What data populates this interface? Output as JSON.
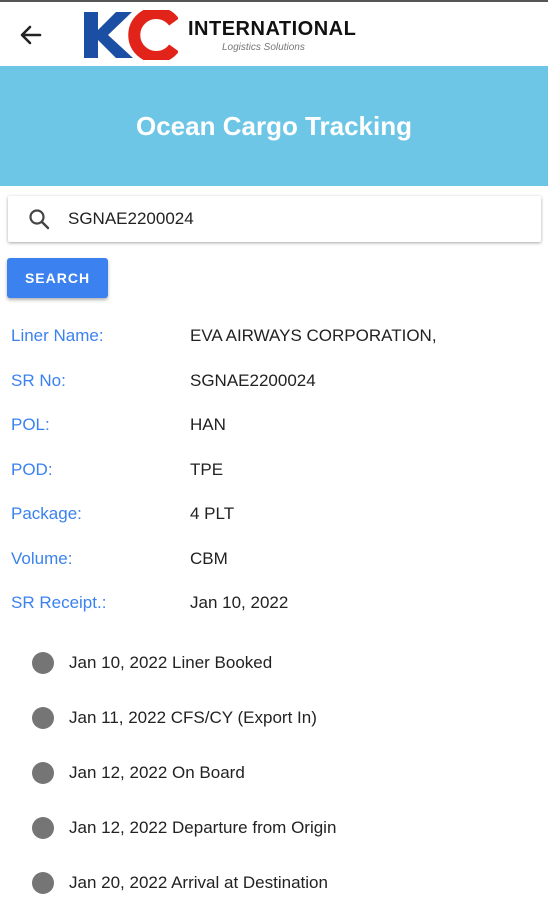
{
  "header": {
    "back_icon": "arrow-left-icon",
    "logo_mark": "KC",
    "logo_title": "INTERNATIONAL",
    "logo_subtitle": "Logistics Solutions",
    "colors": {
      "logo_k": "#1a4fa3",
      "logo_c": "#e2231a"
    }
  },
  "banner": {
    "title": "Ocean Cargo Tracking",
    "color": "#6ec6e6"
  },
  "search": {
    "icon": "search-icon",
    "value": "SGNAE2200024",
    "button_label": "SEARCH",
    "button_color": "#3b82f0"
  },
  "details": [
    {
      "label": "Liner Name:",
      "value": "EVA AIRWAYS CORPORATION,"
    },
    {
      "label": "SR No:",
      "value": "SGNAE2200024"
    },
    {
      "label": "POL:",
      "value": "HAN"
    },
    {
      "label": "POD:",
      "value": "TPE"
    },
    {
      "label": "Package:",
      "value": "4 PLT"
    },
    {
      "label": "Volume:",
      "value": "CBM"
    },
    {
      "label": "SR Receipt.:",
      "value": "Jan 10, 2022"
    }
  ],
  "timeline": [
    {
      "text": "Jan 10, 2022 Liner Booked"
    },
    {
      "text": "Jan 11, 2022 CFS/CY (Export In)"
    },
    {
      "text": "Jan 12, 2022 On Board"
    },
    {
      "text": "Jan 12, 2022 Departure from Origin"
    },
    {
      "text": "Jan 20, 2022 Arrival at Destination"
    }
  ],
  "label_color": "#3b82f0",
  "dot_color": "#757575"
}
